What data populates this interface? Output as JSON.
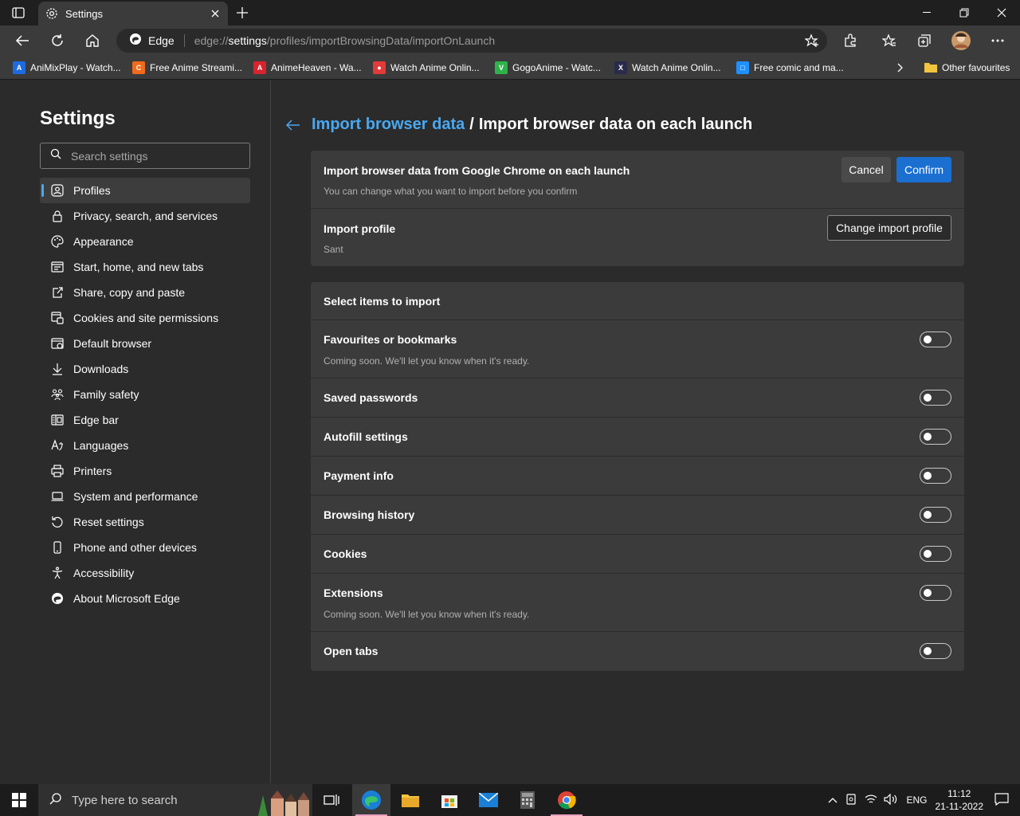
{
  "window": {
    "tab_title": "Settings",
    "controls": [
      "minimize",
      "restore",
      "close"
    ]
  },
  "toolbar": {
    "site_name": "Edge",
    "url_prefix": "edge://",
    "url_host": "settings",
    "url_path": "/profiles/importBrowsingData/importOnLaunch"
  },
  "bookmarks": [
    {
      "label": "AniMixPlay - Watch...",
      "color": "#1e6ae0",
      "glyph": "A"
    },
    {
      "label": "Free Anime Streami...",
      "color": "#f26a1b",
      "glyph": "C"
    },
    {
      "label": "AnimeHeaven - Wa...",
      "color": "#d9232e",
      "glyph": "A"
    },
    {
      "label": "Watch Anime Onlin...",
      "color": "#e23a3a",
      "glyph": "●"
    },
    {
      "label": "GogoAnime - Watc...",
      "color": "#2db34a",
      "glyph": "V"
    },
    {
      "label": "Watch Anime Onlin...",
      "color": "#2a2a4a",
      "glyph": "X"
    },
    {
      "label": "Free comic and ma...",
      "color": "#1e90ff",
      "glyph": "□"
    }
  ],
  "bookmarks_other": "Other favourites",
  "sidebar": {
    "title": "Settings",
    "search_placeholder": "Search settings",
    "items": [
      {
        "label": "Profiles",
        "icon": "profile-icon",
        "active": true
      },
      {
        "label": "Privacy, search, and services",
        "icon": "lock-icon"
      },
      {
        "label": "Appearance",
        "icon": "palette-icon"
      },
      {
        "label": "Start, home, and new tabs",
        "icon": "window-icon"
      },
      {
        "label": "Share, copy and paste",
        "icon": "share-icon"
      },
      {
        "label": "Cookies and site permissions",
        "icon": "cookie-icon"
      },
      {
        "label": "Default browser",
        "icon": "browser-icon"
      },
      {
        "label": "Downloads",
        "icon": "download-icon"
      },
      {
        "label": "Family safety",
        "icon": "family-icon"
      },
      {
        "label": "Edge bar",
        "icon": "edge-bar-icon"
      },
      {
        "label": "Languages",
        "icon": "language-icon"
      },
      {
        "label": "Printers",
        "icon": "printer-icon"
      },
      {
        "label": "System and performance",
        "icon": "laptop-icon"
      },
      {
        "label": "Reset settings",
        "icon": "reset-icon"
      },
      {
        "label": "Phone and other devices",
        "icon": "phone-icon"
      },
      {
        "label": "Accessibility",
        "icon": "accessibility-icon"
      },
      {
        "label": "About Microsoft Edge",
        "icon": "edge-logo-icon"
      }
    ]
  },
  "main": {
    "breadcrumb_link": "Import browser data",
    "breadcrumb_sep": "/",
    "breadcrumb_current": "Import browser data on each launch",
    "import_card": {
      "title": "Import browser data from Google Chrome on each launch",
      "subtitle": "You can change what you want to import before you confirm",
      "cancel": "Cancel",
      "confirm": "Confirm",
      "profile_title": "Import profile",
      "profile_value": "Sant",
      "change_profile": "Change import profile"
    },
    "items_card": {
      "header": "Select items to import",
      "items": [
        {
          "label": "Favourites or bookmarks",
          "note": "Coming soon. We'll let you know when it's ready.",
          "on": false
        },
        {
          "label": "Saved passwords",
          "on": false
        },
        {
          "label": "Autofill settings",
          "on": false
        },
        {
          "label": "Payment info",
          "on": false
        },
        {
          "label": "Browsing history",
          "on": false
        },
        {
          "label": "Cookies",
          "on": false
        },
        {
          "label": "Extensions",
          "note": "Coming soon. We'll let you know when it's ready.",
          "on": false
        },
        {
          "label": "Open tabs",
          "on": false
        }
      ]
    }
  },
  "taskbar": {
    "search_placeholder": "Type here to search",
    "language": "ENG",
    "time": "11:12",
    "date": "21-11-2022"
  },
  "colors": {
    "accent": "#4aa8f0",
    "confirm_bg": "#1a6fd0",
    "card_bg": "#3b3b3b",
    "page_bg": "#2b2b2b"
  }
}
